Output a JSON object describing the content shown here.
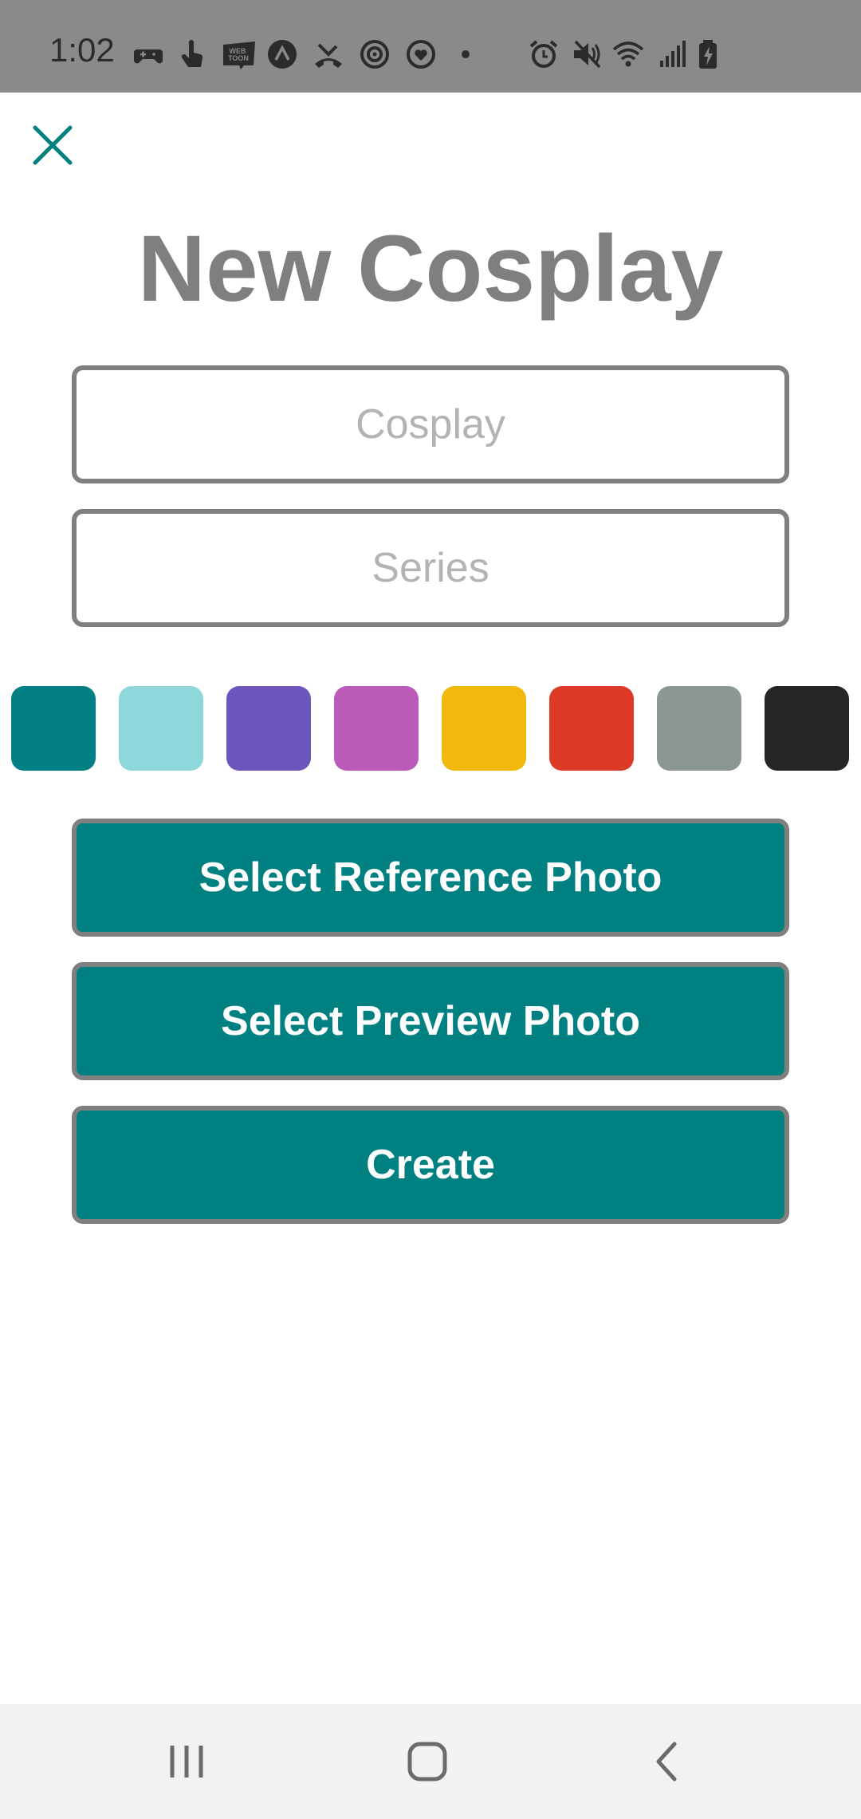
{
  "status_bar": {
    "time": "1:02",
    "left_icons": [
      "game-controller-icon",
      "touch-icon",
      "webtoon-icon",
      "arrow-up-circle-icon",
      "missed-call-icon",
      "target-icon",
      "heart-circle-icon",
      "dot-icon"
    ],
    "right_icons": [
      "alarm-icon",
      "mute-icon",
      "wifi-icon",
      "signal-icon",
      "battery-charging-icon"
    ],
    "webtoon_text": "WEB TOON"
  },
  "close_icon": "close-icon",
  "title": "New Cosplay",
  "form": {
    "cosplay_placeholder": "Cosplay",
    "cosplay_value": "",
    "series_placeholder": "Series",
    "series_value": ""
  },
  "color_swatches": [
    {
      "name": "teal",
      "color": "#028083"
    },
    {
      "name": "light-cyan",
      "color": "#8ED8DC"
    },
    {
      "name": "purple",
      "color": "#6D57BD"
    },
    {
      "name": "magenta",
      "color": "#BB5AB9"
    },
    {
      "name": "yellow",
      "color": "#F0B90B"
    },
    {
      "name": "red",
      "color": "#DD3A28"
    },
    {
      "name": "gray",
      "color": "#8C9794"
    },
    {
      "name": "black",
      "color": "#252526"
    }
  ],
  "buttons": {
    "select_reference": "Select Reference Photo",
    "select_preview": "Select Preview Photo",
    "create": "Create"
  },
  "colors": {
    "accent": "#008080",
    "border": "#7F7F7F",
    "title": "#7F7F7F",
    "placeholder": "#B3B3B3"
  },
  "nav_bar": {
    "icons": [
      "recent-apps-icon",
      "home-icon",
      "back-icon"
    ]
  }
}
